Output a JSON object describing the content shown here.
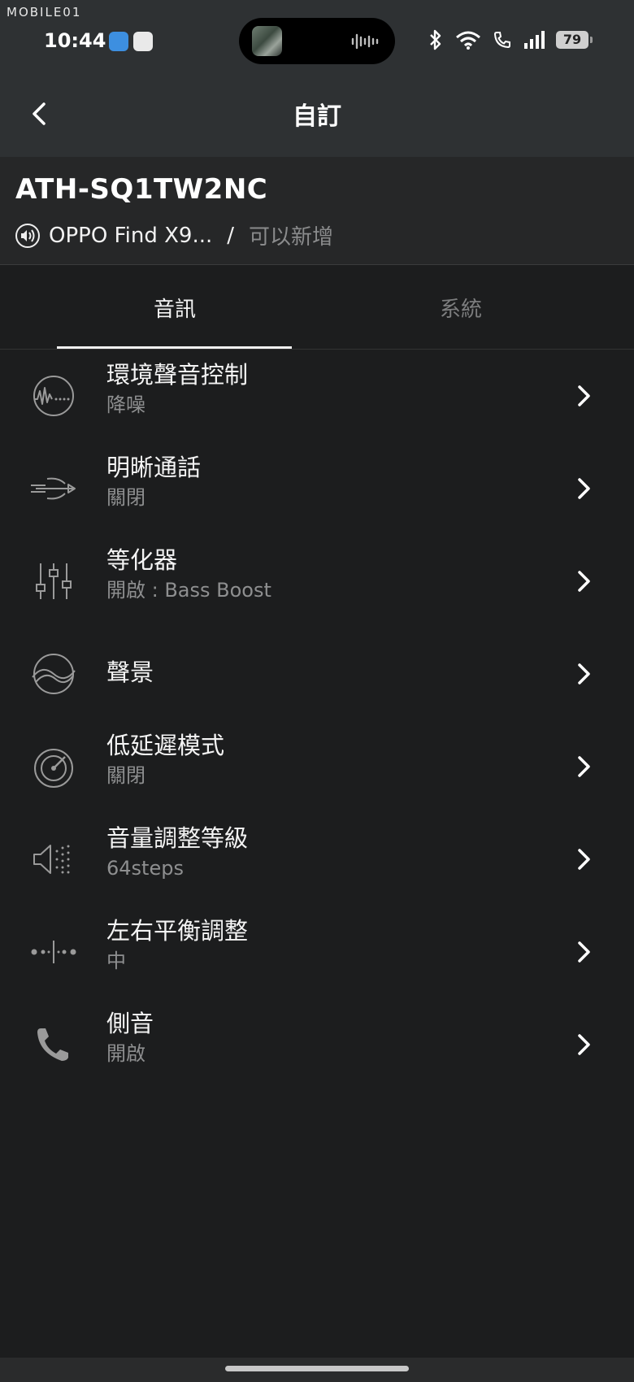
{
  "watermark": "MOBILE01",
  "status_bar": {
    "time": "10:44",
    "battery": "79"
  },
  "header": {
    "title": "自訂"
  },
  "device": {
    "name": "ATH-SQ1TW2NC",
    "connected_device": "OPPO Find X9...",
    "separator": "/",
    "add_label": "可以新增"
  },
  "tabs": [
    {
      "label": "音訊",
      "active": true
    },
    {
      "label": "系統",
      "active": false
    }
  ],
  "settings": [
    {
      "icon": "ambient-sound-icon",
      "title": "環境聲音控制",
      "subtitle": "降噪"
    },
    {
      "icon": "clear-call-icon",
      "title": "明晰通話",
      "subtitle": "關閉"
    },
    {
      "icon": "equalizer-icon",
      "title": "等化器",
      "subtitle": "開啟 : Bass Boost"
    },
    {
      "icon": "soundscape-icon",
      "title": "聲景",
      "subtitle": ""
    },
    {
      "icon": "low-latency-icon",
      "title": "低延遲模式",
      "subtitle": "關閉"
    },
    {
      "icon": "volume-steps-icon",
      "title": "音量調整等級",
      "subtitle": "64steps"
    },
    {
      "icon": "balance-icon",
      "title": "左右平衡調整",
      "subtitle": "中"
    },
    {
      "icon": "phone-icon",
      "title": "側音",
      "subtitle": "開啟"
    }
  ],
  "colors": {
    "background": "#1c1d1e",
    "appbar": "#2e3133",
    "subtitle": "#8e8f90",
    "inactive_tab": "#7d7e7f"
  }
}
